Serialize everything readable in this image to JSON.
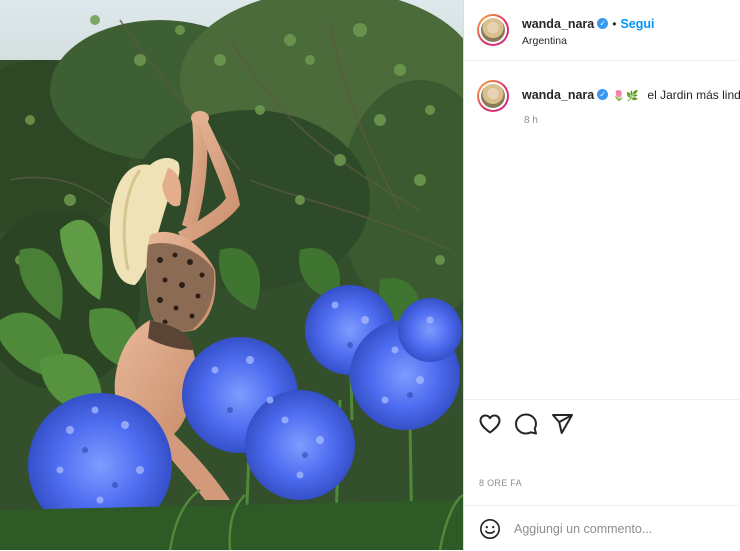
{
  "post": {
    "username": "wanda_nara",
    "follow_label": "Segui",
    "dot": "•",
    "location": "Argentina",
    "caption_username": "wanda_nara",
    "caption_text": "⁠⁠ el Jardin más lindo",
    "caption_emoji": "🌷🌿",
    "caption_time": "8 h",
    "posted_ago": "8 ORE FA",
    "comment_placeholder": "Aggiungi un commento..."
  },
  "icons": {
    "like": "heart-icon",
    "comment": "comment-icon",
    "share": "share-icon",
    "emoji": "emoji-icon",
    "verified": "verified-badge-icon"
  },
  "colors": {
    "accent": "#0095f6",
    "verified": "#3897f0",
    "muted": "#8e8e8e",
    "text": "#262626",
    "flowers": "#4f6ff0"
  }
}
